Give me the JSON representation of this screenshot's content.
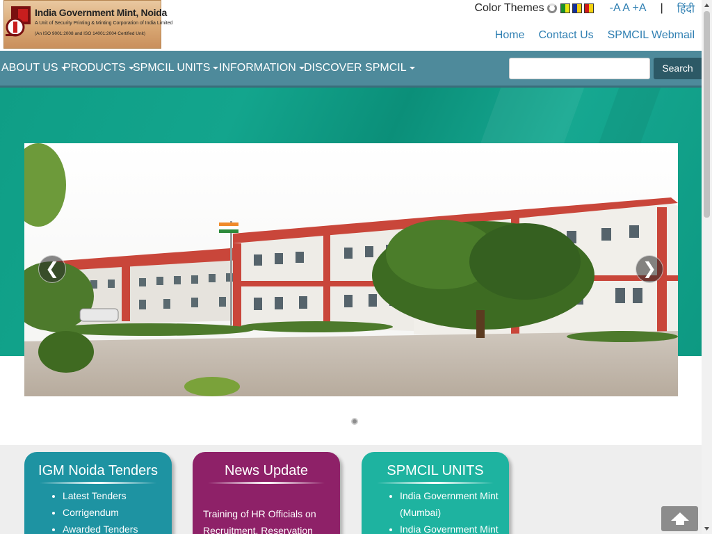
{
  "header": {
    "logo": {
      "title": "India Government Mint, Noida",
      "subtitle": "A Unit of Security Printing & Minting Corporation of India Limited",
      "certification": "(An ISO 9001:2008 and ISO 14001:2004 Certified Unit)"
    },
    "color_themes_label": "Color Themes",
    "font_size_controls": "-A A +A",
    "separator": "|",
    "hindi_link": "हिंदी",
    "top_links": [
      "Home",
      "Contact Us",
      "SPMCIL Webmail"
    ]
  },
  "nav": {
    "items": [
      "ABOUT US",
      "PRODUCTS",
      "SPMCIL UNITS",
      "INFORMATION",
      "DISCOVER SPMCIL"
    ],
    "search_button": "Search",
    "search_placeholder": ""
  },
  "carousel": {
    "prev_symbol": "❮",
    "next_symbol": "❯",
    "slide_count": 1,
    "active_slide": 1
  },
  "cards": {
    "tenders": {
      "title": "IGM Noida Tenders",
      "items": [
        "Latest Tenders",
        "Corrigendum",
        "Awarded Tenders"
      ]
    },
    "news": {
      "title": "News Update",
      "text": "Training of HR Officials on Recruitment, Reservation"
    },
    "units": {
      "title": "SPMCIL UNITS",
      "items": [
        "India Government Mint (Mumbai)",
        "India Government Mint"
      ]
    }
  },
  "colors": {
    "navbar": "#4e8a9b",
    "banner": "#13a58d",
    "card_tenders": "#1e93a2",
    "card_news": "#8e2168",
    "card_units": "#1eb3a0",
    "link": "#2f7fb2"
  }
}
